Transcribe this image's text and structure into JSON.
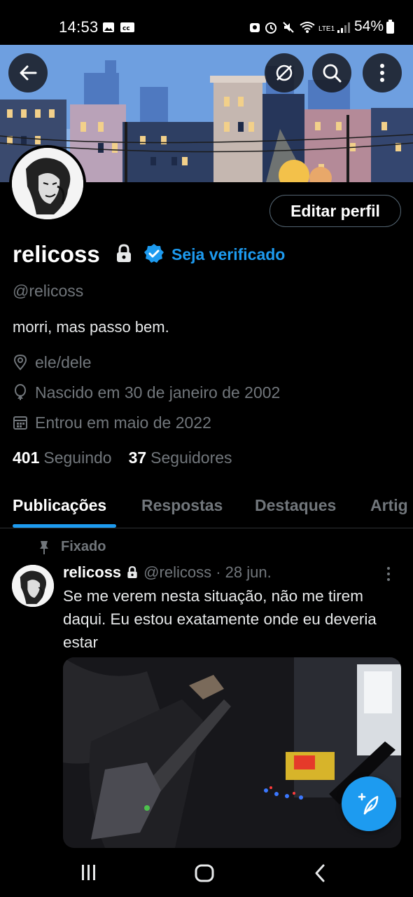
{
  "status_bar": {
    "time": "14:53",
    "battery": "54%",
    "network": "LTE1"
  },
  "header": {
    "back_icon": "arrow-left-icon",
    "hide_icon": "eye-slash-icon",
    "search_icon": "search-icon",
    "more_icon": "more-vertical-icon"
  },
  "profile": {
    "name": "relicoss",
    "verify_cta": "Seja verificado",
    "handle": "@relicoss",
    "bio": "morri, mas passo bem.",
    "location": "ele/dele",
    "birthday": "Nascido em 30 de janeiro de 2002",
    "joined": "Entrou em maio de 2022",
    "following_count": "401",
    "following_label": "Seguindo",
    "followers_count": "37",
    "followers_label": "Seguidores",
    "edit_button": "Editar perfil"
  },
  "tabs": [
    {
      "label": "Publicações",
      "active": true
    },
    {
      "label": "Respostas",
      "active": false
    },
    {
      "label": "Destaques",
      "active": false
    },
    {
      "label": "Artig",
      "active": false
    }
  ],
  "pinned_post": {
    "pinned_label": "Fixado",
    "author": "relicoss",
    "handle_date": "@relicoss · 28 jun.",
    "text": "Se me verem nesta situação, não me tirem daqui. Eu estou exatamente onde eu deveria estar"
  },
  "colors": {
    "accent": "#1d9bf0",
    "background": "#000000",
    "muted": "#71767b",
    "border": "#2f3336"
  }
}
